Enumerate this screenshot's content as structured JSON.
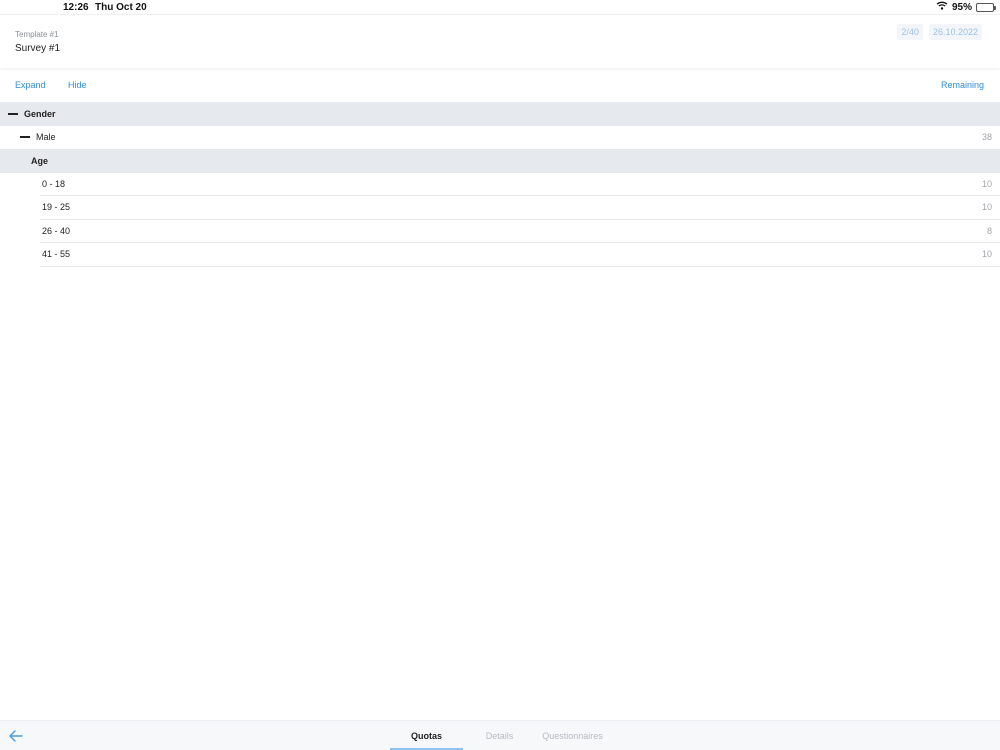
{
  "status_bar": {
    "time": "12:26",
    "date": "Thu Oct 20",
    "battery": "95%",
    "icons": [
      "wifi-icon",
      "battery-icon"
    ]
  },
  "header": {
    "template": "Template #1",
    "survey": "Survey #1",
    "progress": "2/40",
    "date": "26.10.2022"
  },
  "actions": {
    "expand": "Expand",
    "hide": "Hide",
    "remaining": "Remaining"
  },
  "tree": {
    "gender": {
      "label": "Gender"
    },
    "male": {
      "label": "Male",
      "count": "38"
    },
    "age": {
      "label": "Age"
    },
    "ages": [
      {
        "label": "0 - 18",
        "count": "10"
      },
      {
        "label": "19 - 25",
        "count": "10"
      },
      {
        "label": "26 - 40",
        "count": "8"
      },
      {
        "label": "41 - 55",
        "count": "10"
      }
    ]
  },
  "tabs": [
    {
      "label": "Quotas",
      "active": true
    },
    {
      "label": "Details",
      "active": false
    },
    {
      "label": "Questionnaires",
      "active": false
    }
  ],
  "colors": {
    "accent": "#2f8dd9",
    "group_bg": "#e6e9ee",
    "battery_green": "#35c759"
  }
}
